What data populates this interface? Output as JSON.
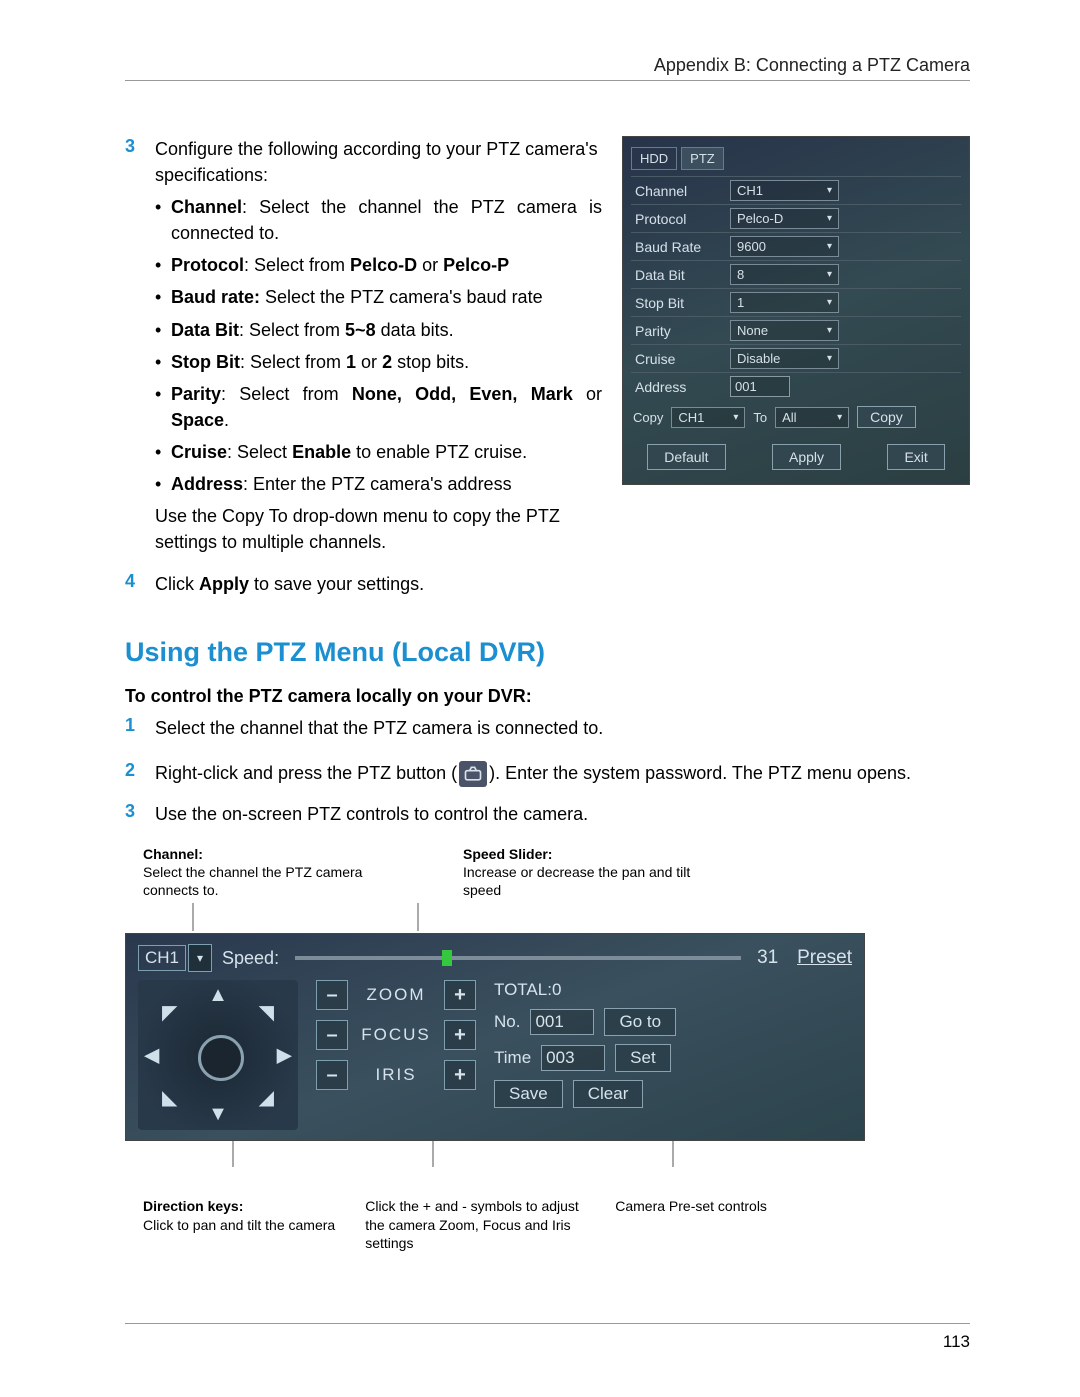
{
  "header": {
    "appendix": "Appendix B: Connecting a PTZ Camera"
  },
  "step3": {
    "num": "3",
    "intro": "Configure the following according to your PTZ camera's specifications:",
    "bullets": [
      {
        "term": "Channel",
        "rest": ": Select the channel the PTZ camera is connected to."
      },
      {
        "term": "Protocol",
        "rest": ": Select from ",
        "b2": "Pelco-D",
        "mid": " or ",
        "b3": "Pelco-P"
      },
      {
        "term": "Baud rate:",
        "rest": " Select the PTZ camera's baud rate"
      },
      {
        "term": "Data Bit",
        "rest": ": Select from ",
        "b2": "5~8",
        "mid": " data bits."
      },
      {
        "term": "Stop Bit",
        "rest": ": Select from ",
        "b2": "1",
        "mid": " or ",
        "b3": "2",
        "tail": " stop bits."
      },
      {
        "term": "Parity",
        "rest": ": Select from ",
        "b2": "None, Odd, Even, Mark",
        "mid": " or ",
        "b3": "Space",
        "tail": "."
      },
      {
        "term": "Cruise",
        "rest": ": Select ",
        "b2": "Enable",
        "mid": " to enable PTZ cruise."
      },
      {
        "term": "Address",
        "rest": ": Enter the PTZ camera's address"
      }
    ],
    "after": "Use the Copy To drop-down menu to copy the PTZ settings to multiple channels."
  },
  "step4": {
    "num": "4",
    "pre": "Click ",
    "b": "Apply",
    "post": " to save your settings."
  },
  "settings_panel": {
    "tabs": [
      "HDD",
      "PTZ"
    ],
    "rows": {
      "Channel": "CH1",
      "Protocol": "Pelco-D",
      "Baud Rate": "9600",
      "Data Bit": "8",
      "Stop Bit": "1",
      "Parity": "None",
      "Cruise": "Disable",
      "Address": "001"
    },
    "copy": {
      "label": "Copy",
      "ch": "CH1",
      "to": "To",
      "all": "All",
      "btn": "Copy"
    },
    "buttons": [
      "Default",
      "Apply",
      "Exit"
    ]
  },
  "heading": "Using the PTZ Menu (Local DVR)",
  "sub": "To control the PTZ camera locally on your DVR:",
  "control_steps": {
    "s1": {
      "num": "1",
      "body": "Select the channel that the PTZ camera is connected to."
    },
    "s2": {
      "num": "2",
      "pre": "Right-click and press the PTZ button (",
      "post": "). Enter the system password. The PTZ menu opens."
    },
    "s3": {
      "num": "3",
      "body": "Use the on-screen PTZ controls to control the camera."
    }
  },
  "callouts_top": {
    "channel": {
      "title": "Channel:",
      "body": "Select the channel the PTZ camera connects to."
    },
    "speed": {
      "title": "Speed Slider:",
      "body": "Increase or decrease the pan and tilt speed"
    }
  },
  "ptz_panel": {
    "ch": "CH1",
    "speed_label": "Speed:",
    "speed_value": "31",
    "zoom": "ZOOM",
    "focus": "FOCUS",
    "iris": "IRIS",
    "preset_title": "Preset",
    "total": "TOTAL:0",
    "no_label": "No.",
    "no_val": "001",
    "goto": "Go to",
    "time_label": "Time",
    "time_val": "003",
    "set": "Set",
    "save": "Save",
    "clear": "Clear"
  },
  "callouts_bottom": {
    "dir": {
      "title": "Direction keys:",
      "body": "Click to pan and tilt the camera"
    },
    "pm": {
      "body": "Click the + and - symbols to adjust the camera Zoom, Focus and Iris settings"
    },
    "pre": {
      "body": "Camera Pre-set controls"
    }
  },
  "page_num": "113"
}
